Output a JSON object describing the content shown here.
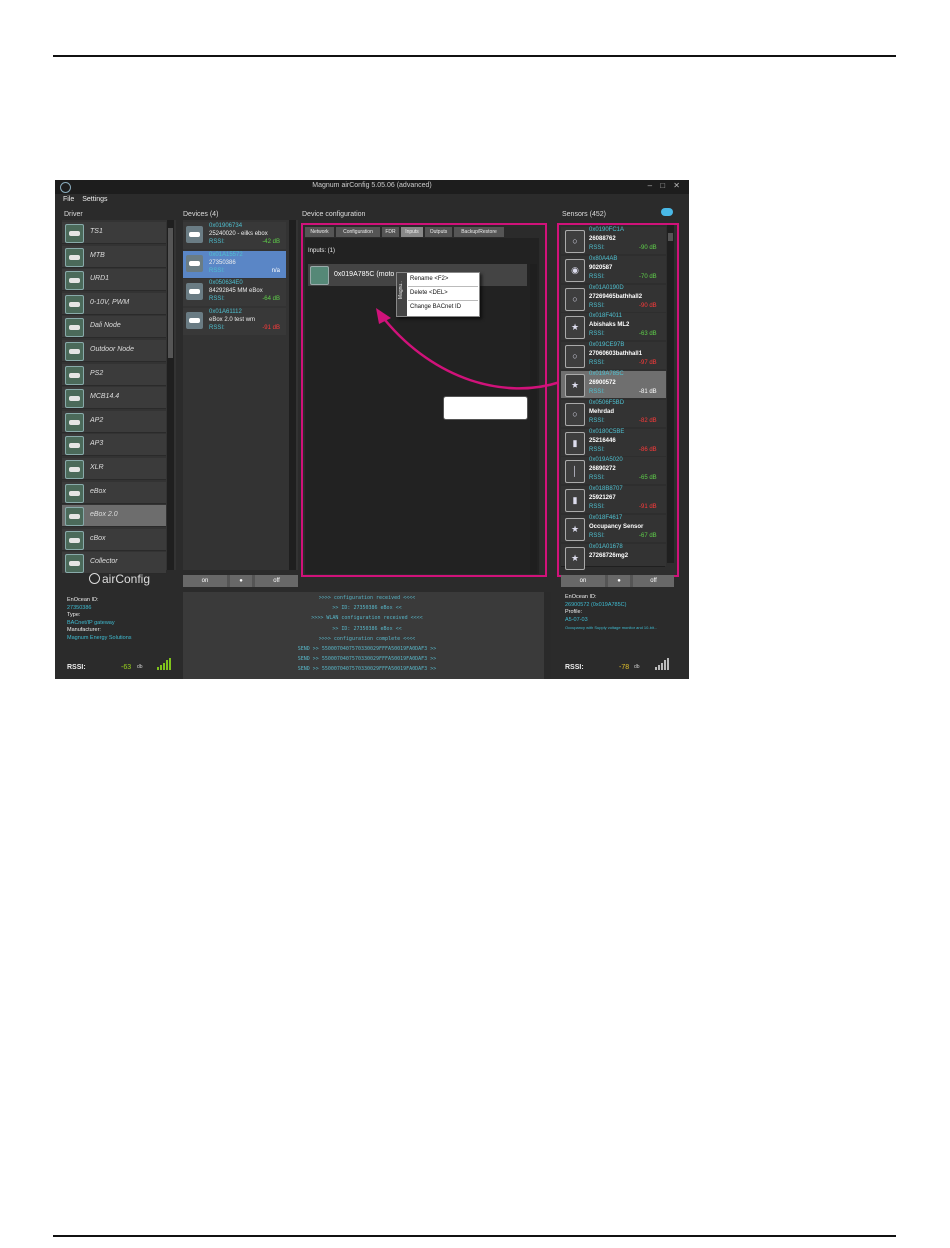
{
  "window": {
    "title": "Magnum airConfig 5.05.06 (advanced)",
    "controls": "– □ ✕"
  },
  "menu": [
    "File",
    "Settings"
  ],
  "headers": {
    "driver": "Driver",
    "devices": "Devices (4)",
    "device_config": "Device configuration",
    "sensors": "Sensors (452)"
  },
  "drivers": [
    "TS1",
    "MTB",
    "URD1",
    "0-10V, PWM",
    "Dali Node",
    "Outdoor Node",
    "PS2",
    "MCB14.4",
    "AP2",
    "AP3",
    "XLR",
    "eBox",
    "eBox 2.0",
    "cBox",
    "Collector"
  ],
  "selected_driver": "eBox 2.0",
  "devices": [
    {
      "id": "0x01906734",
      "name": "25240020 - eilks ebox",
      "rssi_label": "RSSI:",
      "rssi": "-42 dB",
      "rssi_color": "green"
    },
    {
      "id": "0x01A15572",
      "name": "27350386",
      "rssi_label": "RSSI:",
      "rssi": "n/a",
      "rssi_color": "white",
      "selected": true
    },
    {
      "id": "0x050634E0",
      "name": "84292845 MM eBox",
      "rssi_label": "RSSI:",
      "rssi": "-64 dB",
      "rssi_color": "green"
    },
    {
      "id": "0x01A61112",
      "name": "eBox 2.0 test wm",
      "rssi_label": "RSSI:",
      "rssi": "-91 dB",
      "rssi_color": "red"
    }
  ],
  "config": {
    "tabs": [
      "Network",
      "Configuration",
      "FDR",
      "Inputs",
      "Outputs",
      "Backup/Restore"
    ],
    "active_tab": "Inputs",
    "inputs_label": "Inputs: (1)",
    "input_row": "0x019A785C (moto",
    "context_menu": {
      "side_label": "Magnu..",
      "items": [
        "Rename <F2>",
        "Delete <DEL>",
        "Change BACnet ID"
      ]
    }
  },
  "sensors": [
    {
      "id": "0x0190FC1A",
      "name": "26088762",
      "rssi_label": "RSSI:",
      "rssi": "-90 dB",
      "rssi_color": "green",
      "icon": "bulb-icon"
    },
    {
      "id": "0x80A4AB",
      "name": "9020587",
      "rssi_label": "RSSI:",
      "rssi": "-70 dB",
      "rssi_color": "green",
      "icon": "signal-icon"
    },
    {
      "id": "0x01A0190D",
      "name": "27269465bathhall2",
      "rssi_label": "RSSI:",
      "rssi": "-90 dB",
      "rssi_color": "red",
      "icon": "bulb-icon"
    },
    {
      "id": "0x018F4011",
      "name": "Abishaks ML2",
      "rssi_label": "RSSI:",
      "rssi": "-63 dB",
      "rssi_color": "green",
      "icon": "motion-icon"
    },
    {
      "id": "0x019CE97B",
      "name": "27060603bathhall1",
      "rssi_label": "RSSI:",
      "rssi": "-97 dB",
      "rssi_color": "red",
      "icon": "bulb-icon"
    },
    {
      "id": "0x019A785C",
      "name": "26900572",
      "rssi_label": "RSSI:",
      "rssi": "-81 dB",
      "rssi_color": "white",
      "icon": "motion-icon",
      "selected": true
    },
    {
      "id": "0x0506F5BD",
      "name": "Mehrdad",
      "rssi_label": "RSSI:",
      "rssi": "-82 dB",
      "rssi_color": "red",
      "icon": "bulb-icon"
    },
    {
      "id": "0x0180C5BE",
      "name": "25216446",
      "rssi_label": "RSSI:",
      "rssi": "-86 dB",
      "rssi_color": "red",
      "icon": "contact-icon"
    },
    {
      "id": "0x019A5020",
      "name": "26890272",
      "rssi_label": "RSSI:",
      "rssi": "-65 dB",
      "rssi_color": "green",
      "icon": "thermometer-icon"
    },
    {
      "id": "0x018B8707",
      "name": "25921267",
      "rssi_label": "RSSI:",
      "rssi": "-91 dB",
      "rssi_color": "red",
      "icon": "contact-icon"
    },
    {
      "id": "0x018F4617",
      "name": "Occupancy Sensor",
      "rssi_label": "RSSI:",
      "rssi": "-67 dB",
      "rssi_color": "green",
      "icon": "motion-icon"
    },
    {
      "id": "0x01A01678",
      "name": "27268726mg2",
      "rssi_label": "",
      "rssi": "",
      "rssi_color": "green",
      "icon": "motion-icon"
    }
  ],
  "buttons": {
    "on": "on",
    "off": "off"
  },
  "logo_text": "airConfig",
  "left_info": {
    "enocean_id_label": "EnOcean ID:",
    "enocean_id": "27350386",
    "type_label": "Type:",
    "type": "BACnet/IP gateway",
    "manufacturer_label": "Manufacturer:",
    "manufacturer": "Magnum Energy Solutions",
    "rssi_label": "RSSI:",
    "rssi": "-63",
    "rssi_unit": "db"
  },
  "right_info": {
    "enocean_id_label": "EnOcean ID:",
    "enocean_id": "26900572 (0x019A785C)",
    "profile_label": "Profile:",
    "profile": "A5-07-03",
    "profile_desc": "Occupancy with Supply voltage monitor and 10-bit...",
    "rssi_label": "RSSI:",
    "rssi": "-78",
    "rssi_unit": "db"
  },
  "console_lines": [
    ">>>> configuration received <<<<",
    ">> ID: 27350386 eBox <<",
    ">>>> WLAN configuration received <<<<",
    ">> ID: 27350386 eBox <<",
    ">>>> configuration complete <<<<",
    "SEND >> 5500070407570330029FFFA50019FA0DAF3 >>",
    "SEND >> 5500070407570330029FFFA50019FA0DAF3 >>",
    "SEND >> 5500070407570330029FFFA50019FA0DAF3 >>"
  ],
  "colors": {
    "highlight": "#d0127a",
    "accent": "#3fbcd2",
    "good": "#5fd04a",
    "bad": "#ff3a3a"
  }
}
